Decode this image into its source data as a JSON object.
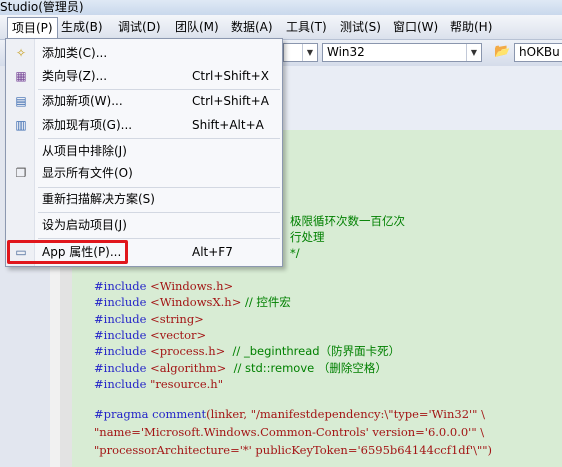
{
  "window": {
    "title_fragment": "Studio(管理员)"
  },
  "menubar": {
    "items": [
      {
        "label": "项目(P)",
        "active": true
      },
      {
        "label": "生成(B)"
      },
      {
        "label": "调试(D)"
      },
      {
        "label": "团队(M)"
      },
      {
        "label": "数据(A)"
      },
      {
        "label": "工具(T)"
      },
      {
        "label": "测试(S)"
      },
      {
        "label": "窗口(W)"
      },
      {
        "label": "帮助(H)"
      }
    ]
  },
  "toolbar": {
    "platform_combo": "Win32",
    "target_combo": "hOKBu"
  },
  "project_menu": {
    "items": [
      {
        "label": "添加类(C)...",
        "shortcut": "",
        "icon": "add-class-icon"
      },
      {
        "label": "类向导(Z)...",
        "shortcut": "Ctrl+Shift+X",
        "icon": "class-wizard-icon"
      },
      {
        "label": "添加新项(W)...",
        "shortcut": "Ctrl+Shift+A",
        "icon": "add-new-item-icon"
      },
      {
        "label": "添加现有项(G)...",
        "shortcut": "Shift+Alt+A",
        "icon": "add-existing-item-icon"
      },
      {
        "label": "从项目中排除(J)",
        "shortcut": "",
        "icon": ""
      },
      {
        "label": "显示所有文件(O)",
        "shortcut": "",
        "icon": "show-all-files-icon"
      },
      {
        "label": "重新扫描解决方案(S)",
        "shortcut": "",
        "icon": ""
      },
      {
        "label": "设为启动项目(J)",
        "shortcut": "",
        "icon": ""
      },
      {
        "label": "App 属性(P)...",
        "shortcut": "Alt+F7",
        "icon": "properties-icon"
      }
    ]
  },
  "code": {
    "fragments": [
      "极限循环次数一百亿次",
      "行处理",
      "*/"
    ],
    "lines": [
      {
        "kw": "#include",
        "rest": " <Windows.h>",
        "cmt": ""
      },
      {
        "kw": "#include",
        "rest": " <WindowsX.h>",
        "cmt": " // 控件宏"
      },
      {
        "kw": "#include",
        "rest": " <string>",
        "cmt": ""
      },
      {
        "kw": "#include",
        "rest": " <vector>",
        "cmt": ""
      },
      {
        "kw": "#include",
        "rest": " <process.h>",
        "cmt": "  // _beginthread（防界面卡死）"
      },
      {
        "kw": "#include",
        "rest": " <algorithm>",
        "cmt": "  // std::remove （删除空格）"
      },
      {
        "kw": "#include",
        "rest": " \"resource.h\"",
        "cmt": ""
      }
    ],
    "pragma_lines": [
      {
        "kw": "#pragma comment",
        "rest": "(linker, \"/manifestdependency:\\\"type='Win32'\" \\"
      },
      {
        "kw": "",
        "rest": "\"name='Microsoft.Windows.Common-Controls' version='6.0.0.0'\" \\"
      },
      {
        "kw": "",
        "rest": "\"processorArchitecture='*' publicKeyToken='6595b64144ccf1df'\\\"\")"
      }
    ]
  }
}
